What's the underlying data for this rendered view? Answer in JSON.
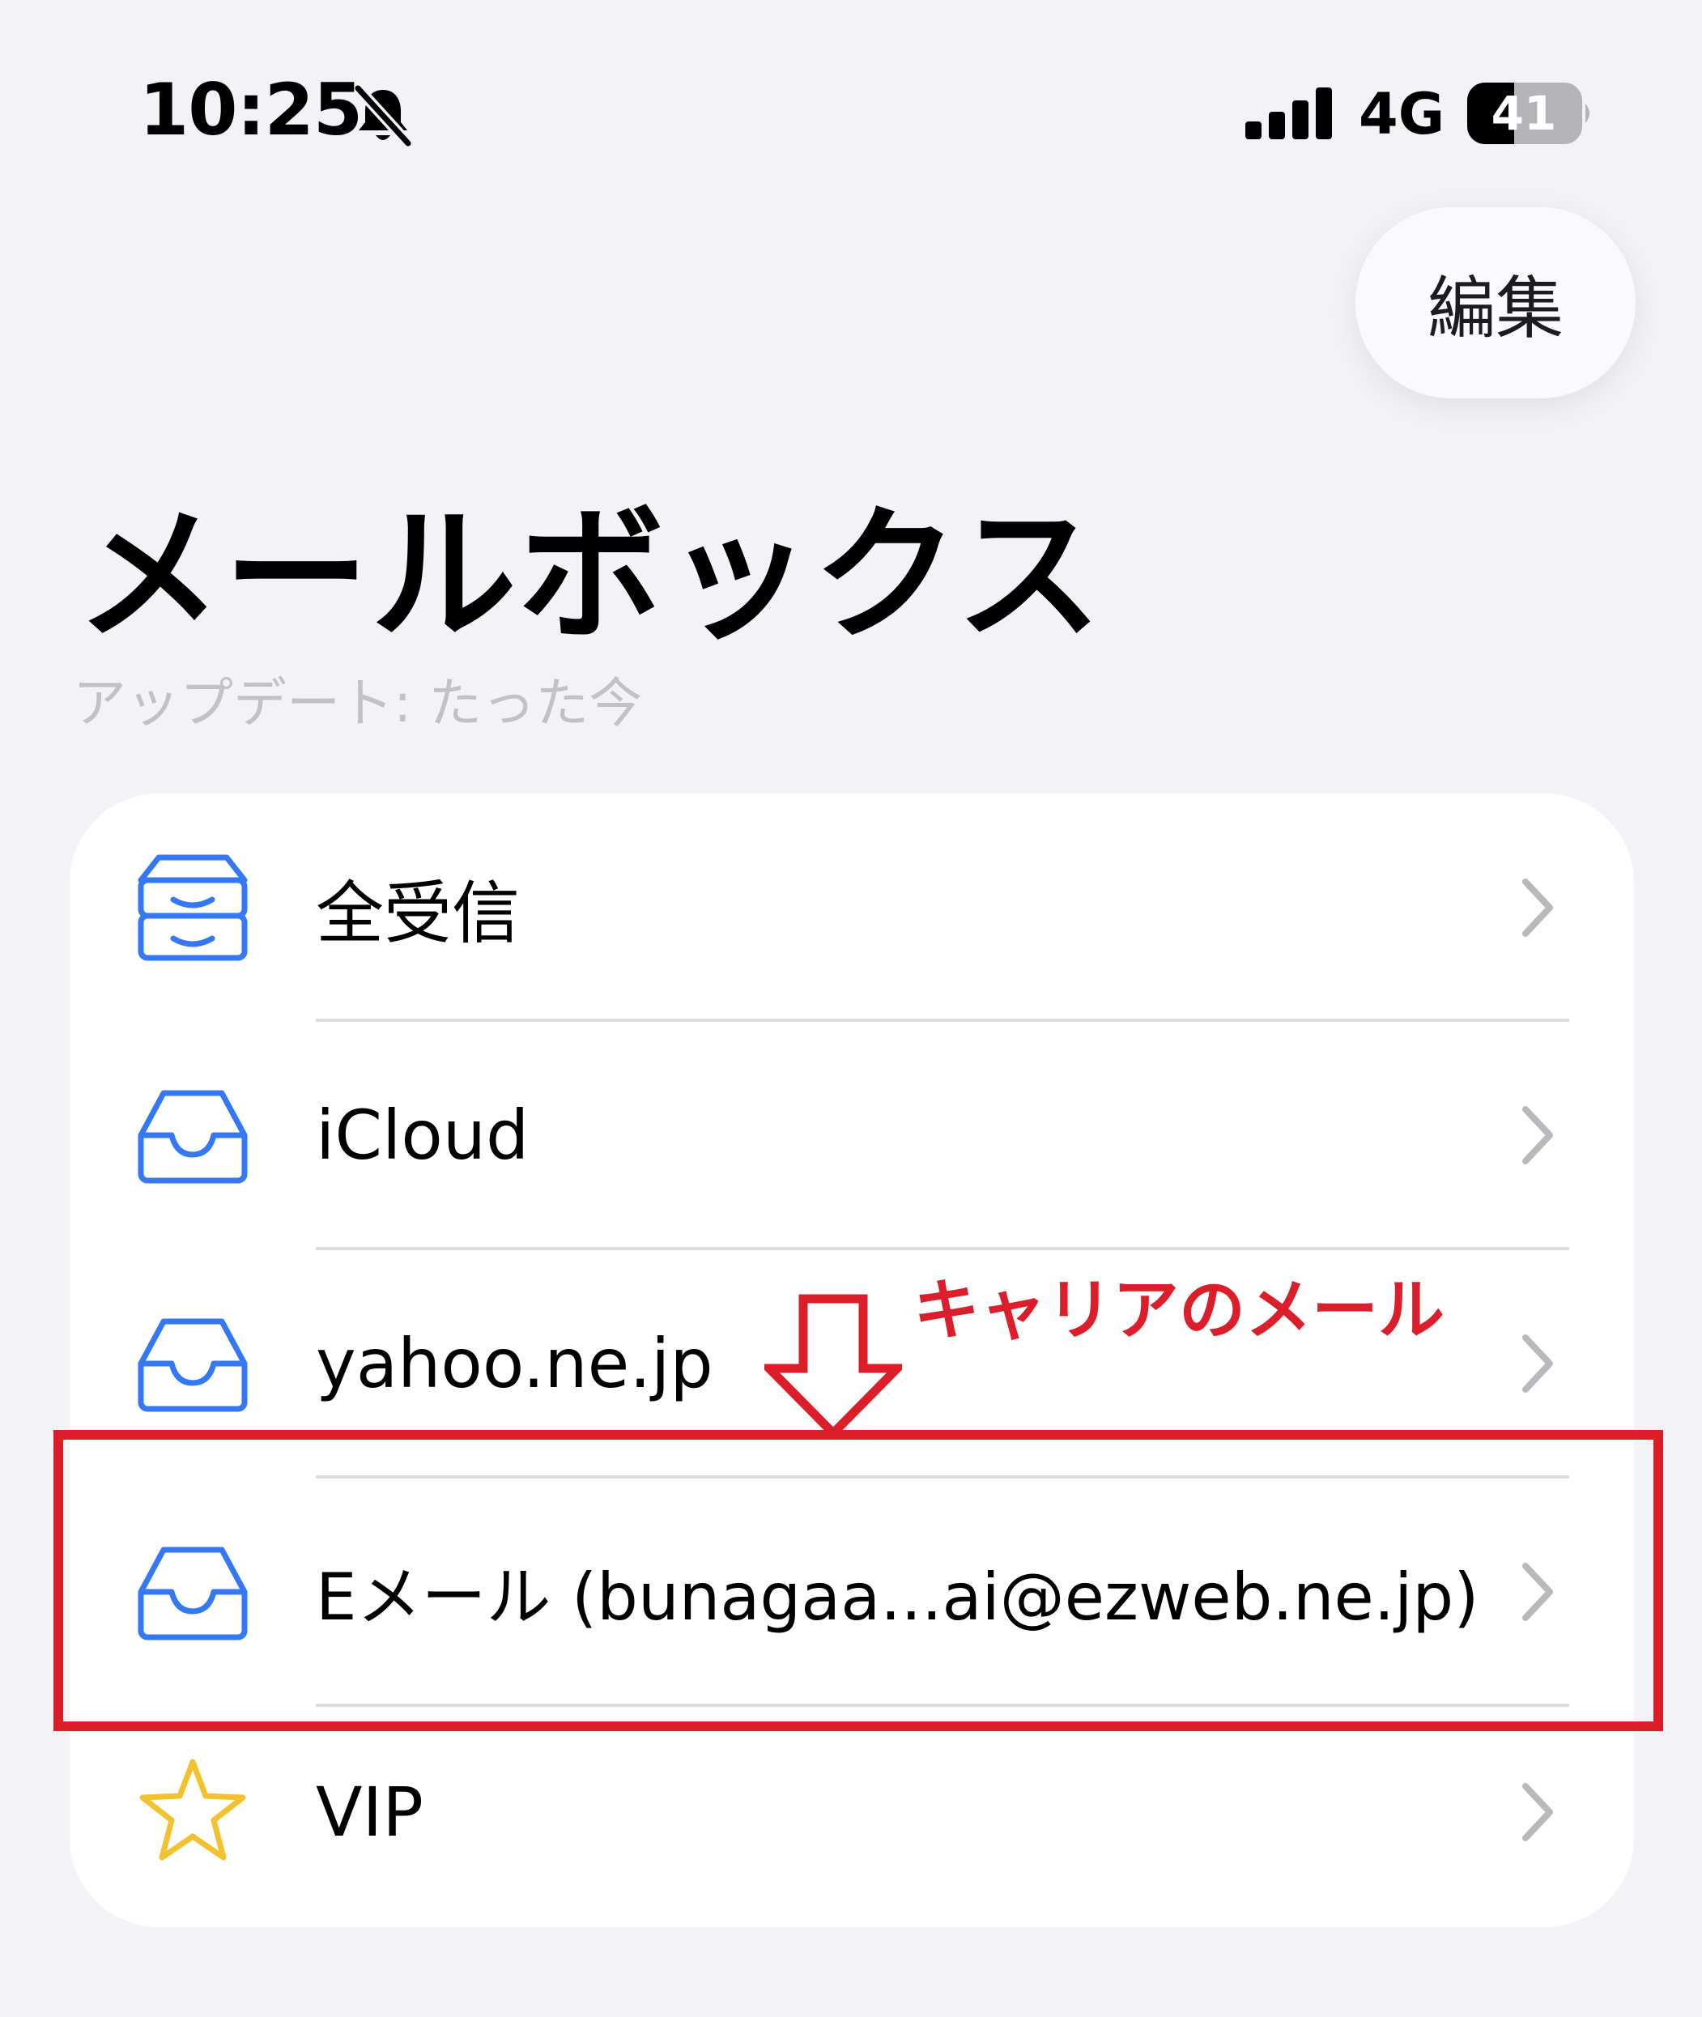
{
  "status_bar": {
    "time": "10:25",
    "network": "4G",
    "battery": "41",
    "icons": [
      "bell-slash-icon",
      "signal-bars-icon",
      "battery-icon"
    ]
  },
  "nav": {
    "edit_label": "編集"
  },
  "header": {
    "title": "メールボックス",
    "update_status": "アップデート: たった今"
  },
  "mailboxes": [
    {
      "label": "全受信",
      "icon": "all-inboxes-icon"
    },
    {
      "label": "iCloud",
      "icon": "inbox-icon"
    },
    {
      "label": "yahoo.ne.jp",
      "icon": "inbox-icon"
    },
    {
      "label": "Eメール (bunagaa...ai@ezweb.ne.jp)",
      "icon": "inbox-icon"
    },
    {
      "label": "VIP",
      "icon": "star-icon"
    }
  ],
  "annotation": {
    "callout": "キャリアのメール"
  },
  "colors": {
    "background": "#f2f2f7",
    "accent_blue": "#3478f6",
    "star_yellow": "#f2c12e",
    "annotation_red": "#dc1e2a",
    "chevron_gray": "#b8b8bd"
  }
}
